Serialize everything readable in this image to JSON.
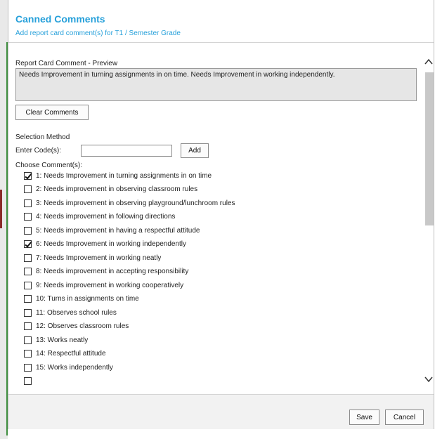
{
  "dialog": {
    "title": "Canned Comments",
    "subtitle": "Add report card comment(s) for T1 / Semester Grade"
  },
  "preview": {
    "label": "Report Card Comment - Preview",
    "text": "Needs Improvement in turning assignments in on time. Needs Improvement in working independently."
  },
  "buttons": {
    "clear": "Clear Comments",
    "add": "Add",
    "save": "Save",
    "cancel": "Cancel"
  },
  "selection": {
    "method_label": "Selection Method",
    "code_label": "Enter Code(s):",
    "code_value": "",
    "choose_label": "Choose Comment(s):"
  },
  "comments": [
    {
      "text": "1: Needs Improvement in turning assignments in on time",
      "checked": true
    },
    {
      "text": "2: Needs improvement in observing classroom rules",
      "checked": false
    },
    {
      "text": "3: Needs improvement in observing playground/lunchroom rules",
      "checked": false
    },
    {
      "text": "4: Needs improvement in following directions",
      "checked": false
    },
    {
      "text": "5: Needs improvement in having a respectful attitude",
      "checked": false
    },
    {
      "text": "6: Needs Improvement in working independently",
      "checked": true
    },
    {
      "text": "7: Needs Improvement in working neatly",
      "checked": false
    },
    {
      "text": "8: Needs improvement in accepting responsibility",
      "checked": false
    },
    {
      "text": "9: Needs improvement in working cooperatively",
      "checked": false
    },
    {
      "text": "10: Turns in assignments on time",
      "checked": false
    },
    {
      "text": "11: Observes school rules",
      "checked": false
    },
    {
      "text": "12: Observes classroom rules",
      "checked": false
    },
    {
      "text": "13: Works neatly",
      "checked": false
    },
    {
      "text": "14: Respectful attitude",
      "checked": false
    },
    {
      "text": "15: Works independently",
      "checked": false
    }
  ],
  "icons": {
    "scroll_up": "chevron-up-icon",
    "scroll_down": "chevron-down-icon"
  },
  "colors": {
    "title": "#26a0da",
    "preview_bg": "#e6e6e6",
    "footer_bg": "#f2f2f2"
  }
}
